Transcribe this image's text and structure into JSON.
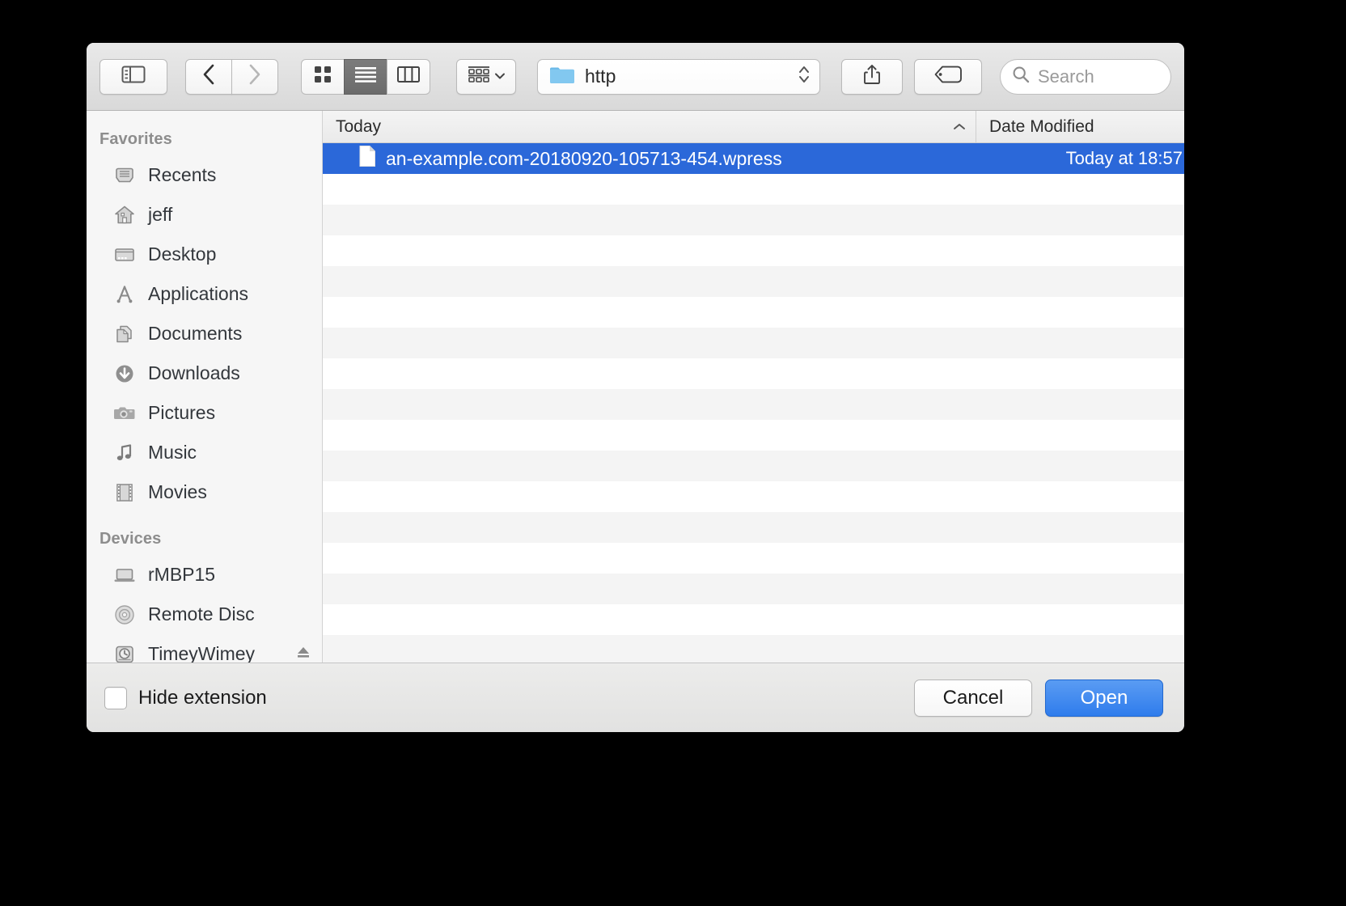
{
  "window": {
    "kind": "macos-open-file-dialog"
  },
  "toolbar": {
    "sidebar_toggle_icon": "sidebar-toggle-icon",
    "back_icon": "chevron-left-icon",
    "forward_icon": "chevron-right-icon",
    "view_icon_grid": "icon-view-icon",
    "view_list": "list-view-icon",
    "view_columns": "column-view-icon",
    "arrange_icon": "arrange-grid-icon",
    "arrange_chevron": "chevron-down-icon",
    "path": {
      "folder_icon": "folder-icon",
      "label": "http",
      "stepper_icon": "up-down-stepper-icon"
    },
    "share_icon": "share-icon",
    "tag_icon": "tag-icon",
    "search": {
      "icon": "search-icon",
      "placeholder": "Search",
      "value": ""
    }
  },
  "sidebar": {
    "sections": [
      {
        "title": "Favorites",
        "items": [
          {
            "label": "Recents",
            "icon": "recents-icon"
          },
          {
            "label": "jeff",
            "icon": "home-icon"
          },
          {
            "label": "Desktop",
            "icon": "desktop-icon"
          },
          {
            "label": "Applications",
            "icon": "applications-icon"
          },
          {
            "label": "Documents",
            "icon": "documents-icon"
          },
          {
            "label": "Downloads",
            "icon": "downloads-icon"
          },
          {
            "label": "Pictures",
            "icon": "pictures-icon"
          },
          {
            "label": "Music",
            "icon": "music-icon"
          },
          {
            "label": "Movies",
            "icon": "movies-icon"
          }
        ]
      },
      {
        "title": "Devices",
        "items": [
          {
            "label": "rMBP15",
            "icon": "laptop-icon"
          },
          {
            "label": "Remote Disc",
            "icon": "optical-disc-icon"
          },
          {
            "label": "TimeyWimey",
            "icon": "time-machine-disk-icon",
            "eject": true
          }
        ]
      }
    ]
  },
  "filelist": {
    "columns": {
      "name": "Today",
      "date": "Date Modified",
      "sort_caret": "chevron-up-icon"
    },
    "rows": [
      {
        "name": "an-example.com-20180920-105713-454.wpress",
        "date": "Today at 18:57",
        "icon": "document-icon",
        "selected": true
      }
    ],
    "empty_row_count": 17
  },
  "footer": {
    "hide_extension_label": "Hide extension",
    "hide_extension_checked": false,
    "cancel_label": "Cancel",
    "open_label": "Open"
  },
  "colors": {
    "selection_blue": "#2b68d9",
    "default_button_blue": "#2f7cec",
    "folder_blue": "#6bb9e8",
    "stripe_gray": "#f4f4f4"
  }
}
